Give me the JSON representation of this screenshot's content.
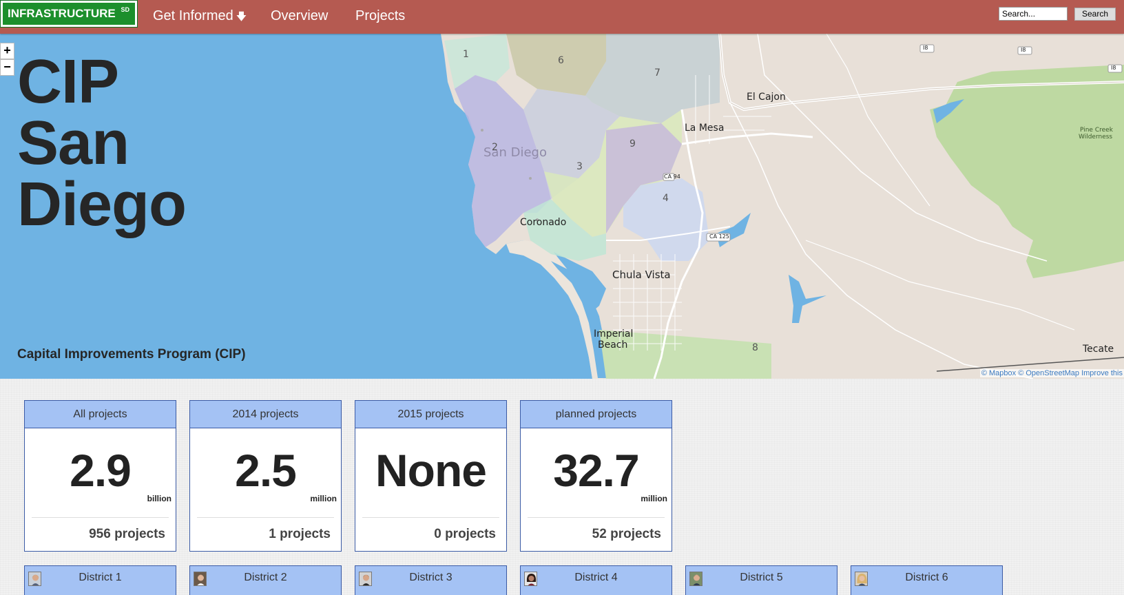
{
  "navbar": {
    "brand": "INFRASTRUCTURE",
    "brand_sup": "SD",
    "menu": [
      {
        "label": "Get Informed",
        "has_dropdown": true
      },
      {
        "label": "Overview"
      },
      {
        "label": "Projects"
      }
    ],
    "search_placeholder": "Search...",
    "search_button": "Search"
  },
  "map": {
    "title_lines": [
      "CIP",
      "San",
      "Diego"
    ],
    "subtitle": "Capital Improvements Program (CIP)",
    "zoom_in": "+",
    "zoom_out": "−",
    "place_labels": [
      "El Cajon",
      "La Mesa",
      "San Diego",
      "Coronado",
      "Chula Vista",
      "Imperial",
      "Beach",
      "Tecate",
      "Pine Creek",
      "Wilderness"
    ],
    "road_labels": [
      "I8",
      "I8",
      "I8",
      "CA 125",
      "CA 94"
    ],
    "district_numbers": [
      "1",
      "2",
      "3",
      "4",
      "6",
      "7",
      "8",
      "9"
    ],
    "attribution": "© Mapbox © OpenStreetMap Improve this"
  },
  "stats": [
    {
      "title": "All projects",
      "value": "2.9",
      "unit": "billion",
      "count": "956 projects"
    },
    {
      "title": "2014 projects",
      "value": "2.5",
      "unit": "million",
      "count": "1 projects"
    },
    {
      "title": "2015 projects",
      "value": "None",
      "unit": "",
      "count": "0 projects"
    },
    {
      "title": "planned projects",
      "value": "32.7",
      "unit": "million",
      "count": "52 projects"
    }
  ],
  "districts": [
    {
      "label": "District 1"
    },
    {
      "label": "District 2"
    },
    {
      "label": "District 3"
    },
    {
      "label": "District 4"
    },
    {
      "label": "District 5"
    },
    {
      "label": "District 6"
    }
  ],
  "colors": {
    "navbar": "#b55a51",
    "brand": "#1c8f2c",
    "water": "#6fb3e3",
    "card_header": "#a4c2f4",
    "card_border": "#3a5aa5"
  }
}
